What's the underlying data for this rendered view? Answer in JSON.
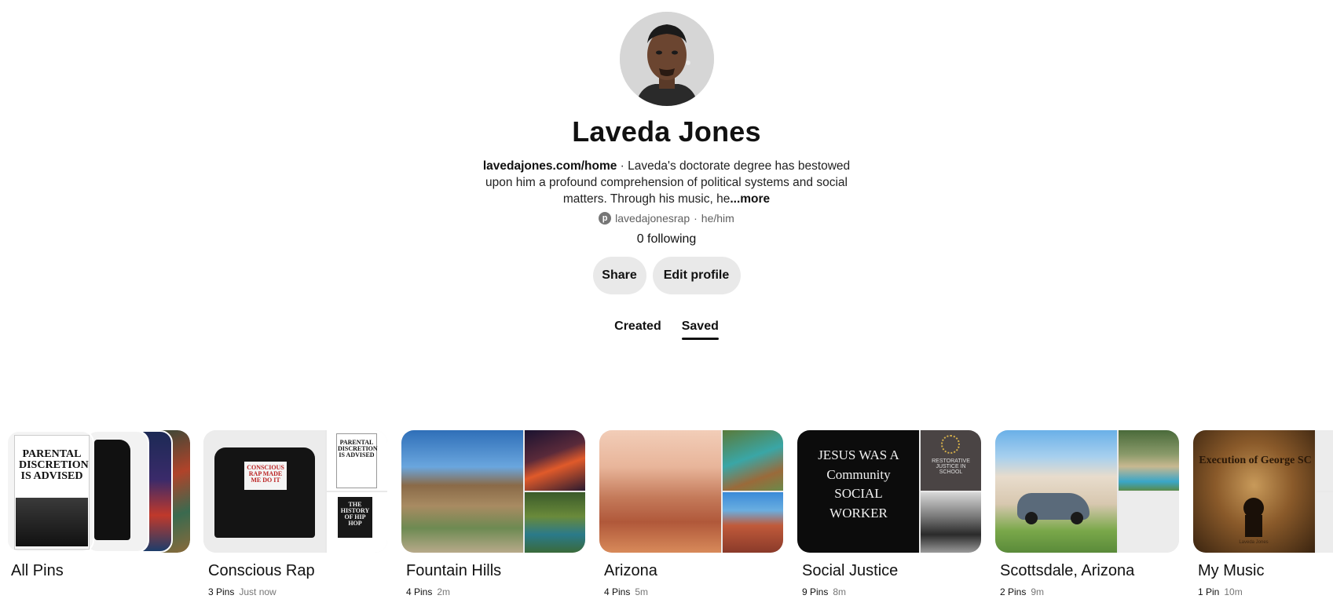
{
  "profile": {
    "name": "Laveda Jones",
    "website": "lavedajones.com/home",
    "bio_separator": " · ",
    "bio": "Laveda's doctorate degree has bestowed upon him a profound comprehension of political systems and social matters. Through his music, he",
    "more_label": "...more",
    "username": "lavedajonesrap",
    "pronouns": "he/him",
    "following": "0 following",
    "share_label": "Share",
    "edit_label": "Edit profile"
  },
  "tabs": [
    {
      "label": "Created",
      "active": false
    },
    {
      "label": "Saved",
      "active": true
    }
  ],
  "boards": [
    {
      "title": "All Pins",
      "pins": "",
      "time": ""
    },
    {
      "title": "Conscious Rap",
      "pins": "3 Pins",
      "time": "Just now"
    },
    {
      "title": "Fountain Hills",
      "pins": "4 Pins",
      "time": "2m"
    },
    {
      "title": "Arizona",
      "pins": "4 Pins",
      "time": "5m"
    },
    {
      "title": "Social Justice",
      "pins": "9 Pins",
      "time": "8m"
    },
    {
      "title": "Scottsdale, Arizona",
      "pins": "2 Pins",
      "time": "9m"
    },
    {
      "title": "My Music",
      "pins": "1 Pin",
      "time": "10m"
    }
  ],
  "cover_text": {
    "parental": "PARENTAL DISCRETION IS ADVISED",
    "conscious_shirt": "CONSCIOUS RAP MADE ME DO IT",
    "history": "THE HISTORY OF HIP HOP",
    "jesus": "JESUS WAS A Community SOCIAL WORKER",
    "restorative": "RESTORATIVE JUSTICE IN SCHOOL",
    "music_title": "Execution of George SC",
    "music_artist": "Laveda Jones"
  }
}
